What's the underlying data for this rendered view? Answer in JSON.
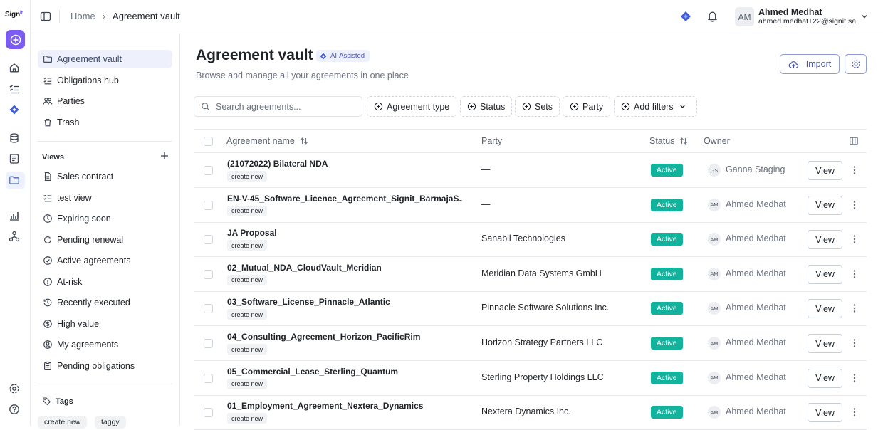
{
  "app": {
    "logo": "Sign",
    "logo_suffix": "it"
  },
  "breadcrumb": {
    "home": "Home",
    "separator": "›",
    "current": "Agreement vault"
  },
  "user": {
    "initials": "AM",
    "name": "Ahmed Medhat",
    "email": "ahmed.medhat+22@signit.sa"
  },
  "sidebar": {
    "main_items": [
      {
        "label": "Agreement vault",
        "icon": "folder-icon",
        "active": true
      },
      {
        "label": "Obligations hub",
        "icon": "checklist-icon"
      },
      {
        "label": "Parties",
        "icon": "users-icon"
      },
      {
        "label": "Trash",
        "icon": "trash-icon"
      }
    ],
    "views_heading": "Views",
    "views": [
      {
        "label": "Sales contract",
        "icon": "document-icon"
      },
      {
        "label": "test view",
        "icon": "checklist-icon"
      },
      {
        "label": "Expiring soon",
        "icon": "clock-icon"
      },
      {
        "label": "Pending renewal",
        "icon": "refresh-icon"
      },
      {
        "label": "Active agreements",
        "icon": "check-circle-icon"
      },
      {
        "label": "At-risk",
        "icon": "alert-circle-icon"
      },
      {
        "label": "Recently executed",
        "icon": "history-icon"
      },
      {
        "label": "High value",
        "icon": "dollar-icon"
      },
      {
        "label": "My agreements",
        "icon": "user-icon"
      },
      {
        "label": "Pending obligations",
        "icon": "clipboard-icon"
      }
    ],
    "tags_heading": "Tags",
    "tags": [
      "create new",
      "taggy"
    ]
  },
  "page": {
    "title": "Agreement vault",
    "ai_badge": "AI-Assisted",
    "subtitle": "Browse and manage all your agreements in one place",
    "import_label": "Import"
  },
  "search": {
    "placeholder": "Search agreements..."
  },
  "filters": [
    "Agreement type",
    "Status",
    "Sets",
    "Party",
    "Add filters"
  ],
  "table": {
    "headers": {
      "name": "Agreement name",
      "party": "Party",
      "status": "Status",
      "owner": "Owner"
    },
    "view_label": "View",
    "rows": [
      {
        "name": "(21072022) Bilateral NDA",
        "tag": "create new",
        "party": "—",
        "status": "Active",
        "owner_initials": "GS",
        "owner": "Ganna Staging"
      },
      {
        "name": "EN-V-45_Software_Licence_Agreement_Signit_BarmajaS...",
        "tag": "create new",
        "party": "—",
        "status": "Active",
        "owner_initials": "AM",
        "owner": "Ahmed Medhat"
      },
      {
        "name": "JA Proposal",
        "tag": "create new",
        "party": "Sanabil Technologies",
        "status": "Active",
        "owner_initials": "AM",
        "owner": "Ahmed Medhat"
      },
      {
        "name": "02_Mutual_NDA_CloudVault_Meridian",
        "tag": "create new",
        "party": "Meridian Data Systems GmbH",
        "status": "Active",
        "owner_initials": "AM",
        "owner": "Ahmed Medhat"
      },
      {
        "name": "03_Software_License_Pinnacle_Atlantic",
        "tag": "create new",
        "party": "Pinnacle Software Solutions Inc.",
        "status": "Active",
        "owner_initials": "AM",
        "owner": "Ahmed Medhat"
      },
      {
        "name": "04_Consulting_Agreement_Horizon_PacificRim",
        "tag": "create new",
        "party": "Horizon Strategy Partners LLC",
        "status": "Active",
        "owner_initials": "AM",
        "owner": "Ahmed Medhat"
      },
      {
        "name": "05_Commercial_Lease_Sterling_Quantum",
        "tag": "create new",
        "party": "Sterling Property Holdings LLC",
        "status": "Active",
        "owner_initials": "AM",
        "owner": "Ahmed Medhat"
      },
      {
        "name": "01_Employment_Agreement_Nextera_Dynamics",
        "tag": "create new",
        "party": "Nextera Dynamics Inc.",
        "status": "Active",
        "owner_initials": "AM",
        "owner": "Ahmed Medhat"
      }
    ]
  },
  "colors": {
    "accent": "#7a5cf0",
    "status_active": "#12b39d",
    "sidebar_active_bg": "#eef1fb"
  }
}
